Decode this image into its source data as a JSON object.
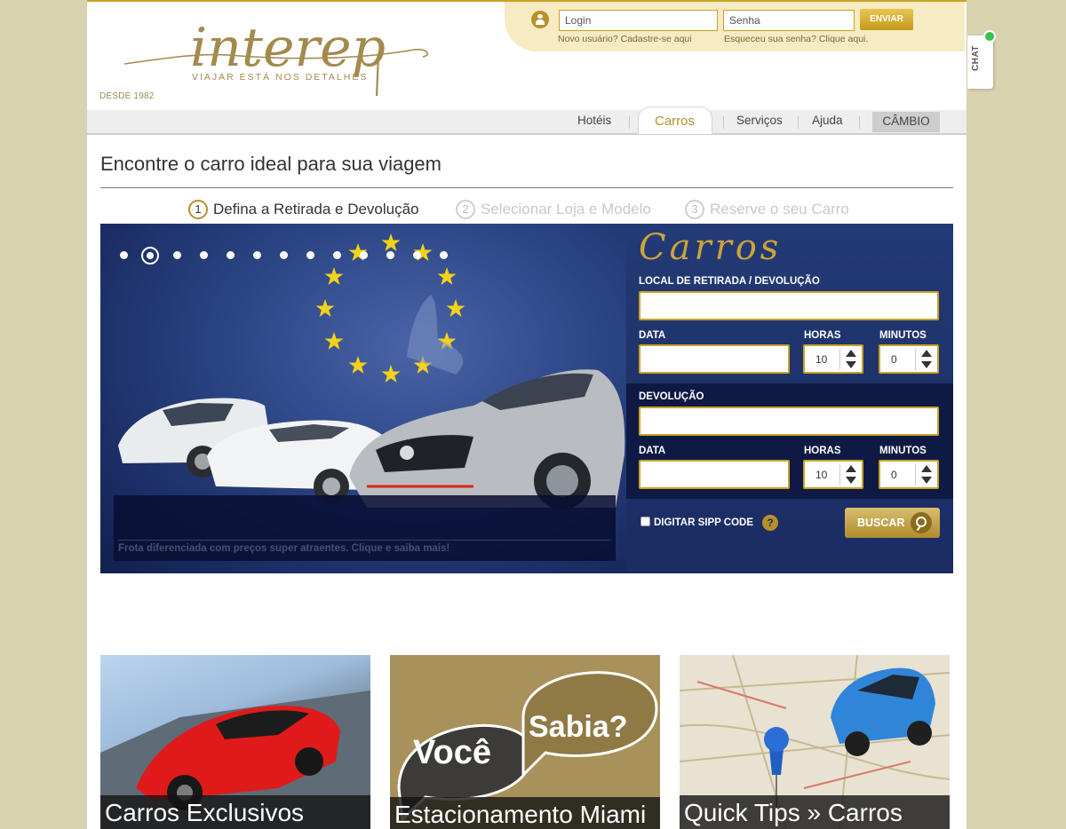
{
  "header": {
    "logo_text": "interep",
    "tagline": "VIAJAR ESTÁ NOS DETALHES",
    "since": "DESDE 1982"
  },
  "login": {
    "login_placeholder": "Login",
    "password_placeholder": "Senha",
    "submit_label": "ENVIAR",
    "new_user_text": "Novo usuário? Cadastre-se aqui",
    "forgot_text": "Esqueceu sua senha? Clique aqui."
  },
  "nav": {
    "items": [
      {
        "label": "Hotéis"
      },
      {
        "label": "Carros"
      },
      {
        "label": "Serviços"
      },
      {
        "label": "Ajuda"
      }
    ],
    "active_index": 1,
    "cambio_label": "CÂMBIO"
  },
  "chat": {
    "label": "CHAT",
    "status_color": "#39c04a"
  },
  "page": {
    "title": "Encontre o carro ideal para sua viagem"
  },
  "steps": [
    {
      "number": "1",
      "label": "Defina a Retirada e Devolução",
      "active": true
    },
    {
      "number": "2",
      "label": "Selecionar Loja e Modelo",
      "active": false
    },
    {
      "number": "3",
      "label": "Reserve o seu Carro",
      "active": false
    }
  ],
  "banner": {
    "caption": "Frota diferenciada com preços super atraentes. Clique e saiba mais!",
    "slide_count": 13,
    "active_slide": 2
  },
  "search": {
    "panel_title": "Carros",
    "pickup_location_label": "LOCAL DE RETIRADA / DEVOLUÇÃO",
    "pickup_date_label": "DATA",
    "pickup_hours_label": "HORAS",
    "pickup_minutes_label": "MINUTOS",
    "pickup_hours_value": "10",
    "pickup_minutes_value": "0",
    "return_label": "DEVOLUÇÃO",
    "return_date_label": "DATA",
    "return_hours_label": "HORAS",
    "return_minutes_label": "MINUTOS",
    "return_hours_value": "10",
    "return_minutes_value": "0",
    "sipp_label": "DIGITAR SIPP CODE",
    "help_label": "?",
    "search_button": "BUSCAR"
  },
  "tiles": [
    {
      "caption": "Carros Exclusivos"
    },
    {
      "caption": "Estacionamento Miami",
      "bubble_left": "Você",
      "bubble_right": "Sabia?"
    },
    {
      "caption": "Quick Tips » Carros"
    }
  ],
  "colors": {
    "gold": "#c9a227",
    "navy": "#1f336b",
    "background": "#d9d2ae"
  }
}
